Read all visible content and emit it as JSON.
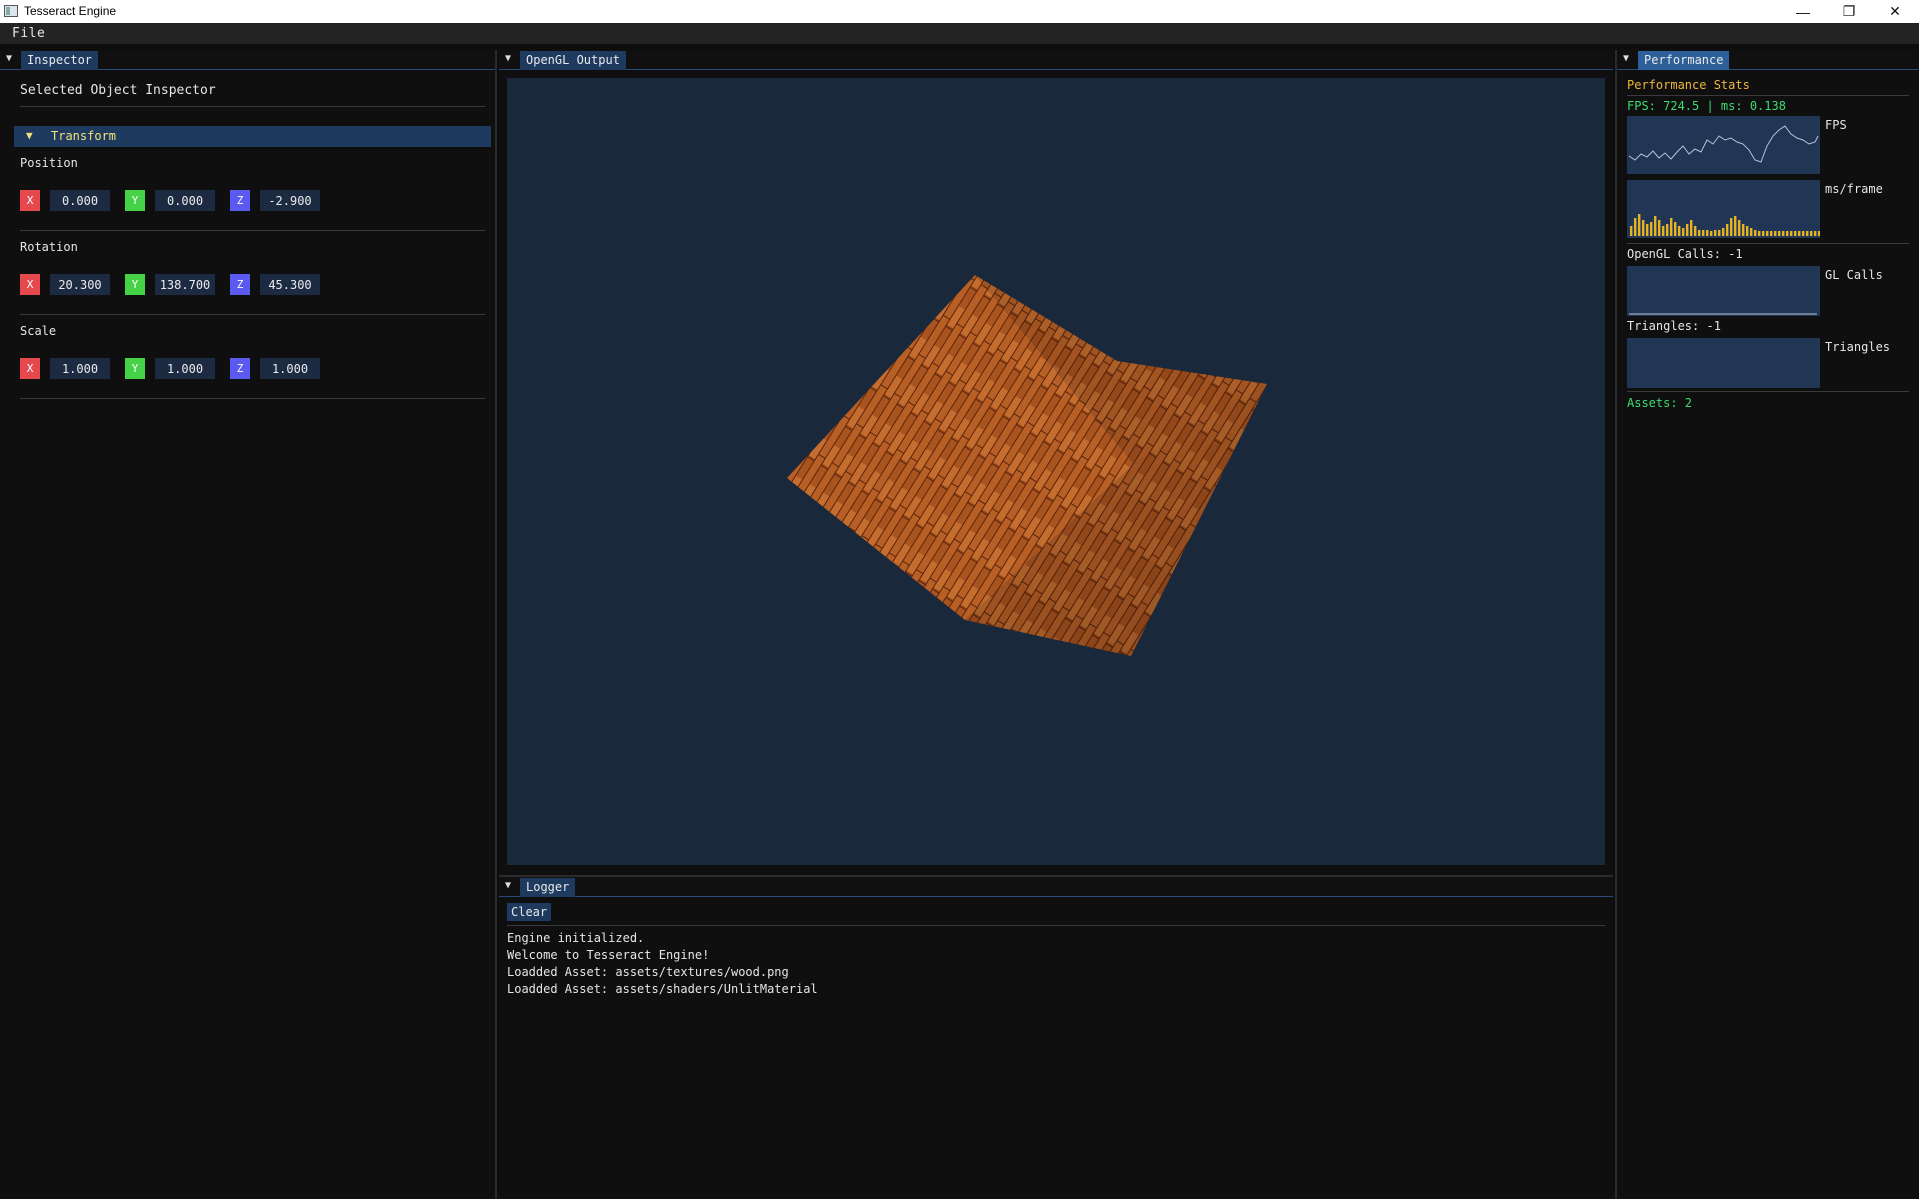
{
  "window": {
    "title": "Tesseract Engine",
    "controls": {
      "minimize": "—",
      "maximize": "❐",
      "close": "✕"
    }
  },
  "menu": {
    "items": [
      "File"
    ]
  },
  "inspector": {
    "tab": "Inspector",
    "heading": "Selected Object Inspector",
    "transform_label": "Transform",
    "position": {
      "label": "Position",
      "x": "0.000",
      "y": "0.000",
      "z": "-2.900"
    },
    "rotation": {
      "label": "Rotation",
      "x": "20.300",
      "y": "138.700",
      "z": "45.300"
    },
    "scale": {
      "label": "Scale",
      "x": "1.000",
      "y": "1.000",
      "z": "1.000"
    },
    "axis_letters": {
      "x": "X",
      "y": "Y",
      "z": "Z"
    }
  },
  "viewport": {
    "tab": "OpenGL Output"
  },
  "logger": {
    "tab": "Logger",
    "clear_label": "Clear",
    "lines": [
      "Engine initialized.",
      "Welcome to Tesseract Engine!",
      "Loadded Asset: assets/textures/wood.png",
      "Loadded Asset: assets/shaders/UnlitMaterial"
    ]
  },
  "performance": {
    "tab": "Performance",
    "title": "Performance Stats",
    "fps_line": "FPS: 724.5 | ms: 0.138",
    "fps_graph_label": "FPS",
    "ms_graph_label": "ms/frame",
    "gl_calls_text": "OpenGL Calls: -1",
    "gl_graph_label": "GL Calls",
    "triangles_text": "Triangles: -1",
    "triangles_graph_label": "Triangles",
    "assets_line": "Assets: 2"
  },
  "colors": {
    "accent": "#1f3a5f",
    "active_tab": "#2d5f9a",
    "axis_x": "#e5484d",
    "axis_y": "#46d246",
    "axis_z": "#5a5af0",
    "stats_green": "#3ddc70",
    "stats_title": "#f0b63d",
    "viewport_bg": "#19283a"
  }
}
